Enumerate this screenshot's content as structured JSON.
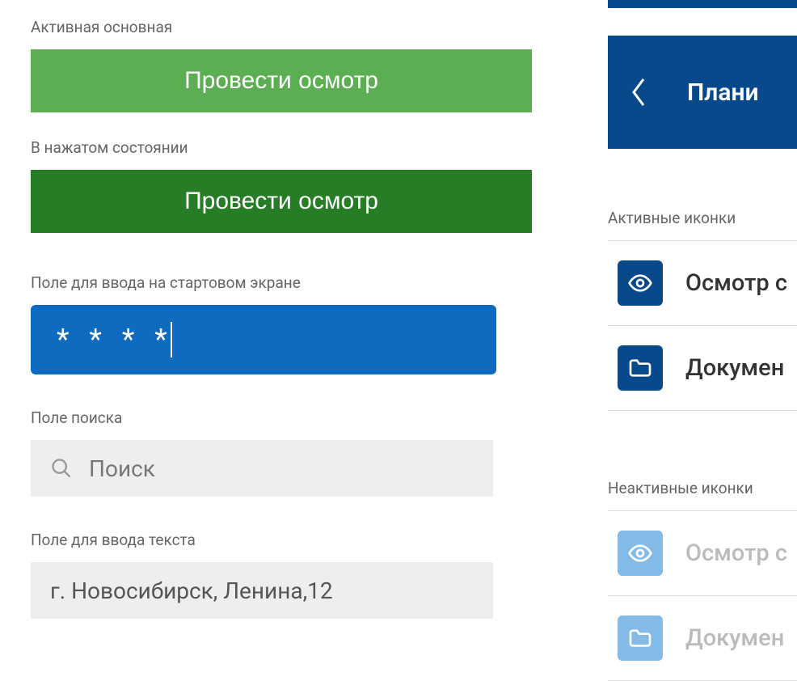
{
  "left": {
    "activePrimaryLabel": "Активная основная",
    "activePrimaryButton": "Провести осмотр",
    "pressedLabel": "В нажатом состоянии",
    "pressedButton": "Провести осмотр",
    "inputStartLabel": "Поле для ввода на стартовом экране",
    "pinMask": "* * * *",
    "searchLabel": "Поле поиска",
    "searchPlaceholder": "Поиск",
    "textInputLabel": "Поле для ввода текста",
    "textInputValue": "г. Новосибирск, Ленина,12"
  },
  "right": {
    "navTitle": "Плани",
    "activeIconsLabel": "Активные иконки",
    "inactiveIconsLabel": "Неактивные иконки",
    "items": [
      {
        "label": "Осмотр с"
      },
      {
        "label": "Докумен"
      }
    ],
    "inactiveItems": [
      {
        "label": "Осмотр с"
      },
      {
        "label": "Докумен"
      }
    ]
  },
  "colors": {
    "greenPrimary": "#5bae52",
    "greenPressed": "#267d26",
    "bluePrimary": "#0e6bbf",
    "blueDark": "#08498b",
    "blueInactive": "#84bbe6",
    "grayBg": "#eeeeee",
    "textMuted": "#666666",
    "textInactive": "#bbbbbb"
  }
}
